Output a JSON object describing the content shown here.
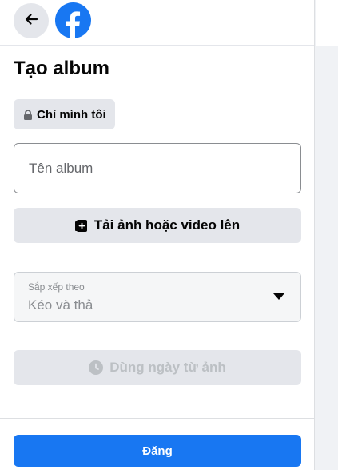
{
  "header": {
    "back_icon": "arrow-left-icon",
    "logo_icon": "facebook-logo-icon"
  },
  "page": {
    "title": "Tạo album"
  },
  "privacy": {
    "icon": "lock-icon",
    "label": "Chỉ mình tôi"
  },
  "album_name": {
    "placeholder": "Tên album",
    "value": ""
  },
  "upload": {
    "icon": "add-photo-icon",
    "label": "Tải ảnh hoặc video lên"
  },
  "sort": {
    "label": "Sắp xếp theo",
    "value": "Kéo và thả",
    "icon": "caret-down-icon"
  },
  "date_from_photos": {
    "icon": "clock-icon",
    "label": "Dùng ngày từ ảnh",
    "disabled": true
  },
  "footer": {
    "post_label": "Đăng"
  },
  "colors": {
    "brand": "#1877f2",
    "button_bg": "#e4e6eb",
    "disabled_text": "#bcc0c4"
  }
}
